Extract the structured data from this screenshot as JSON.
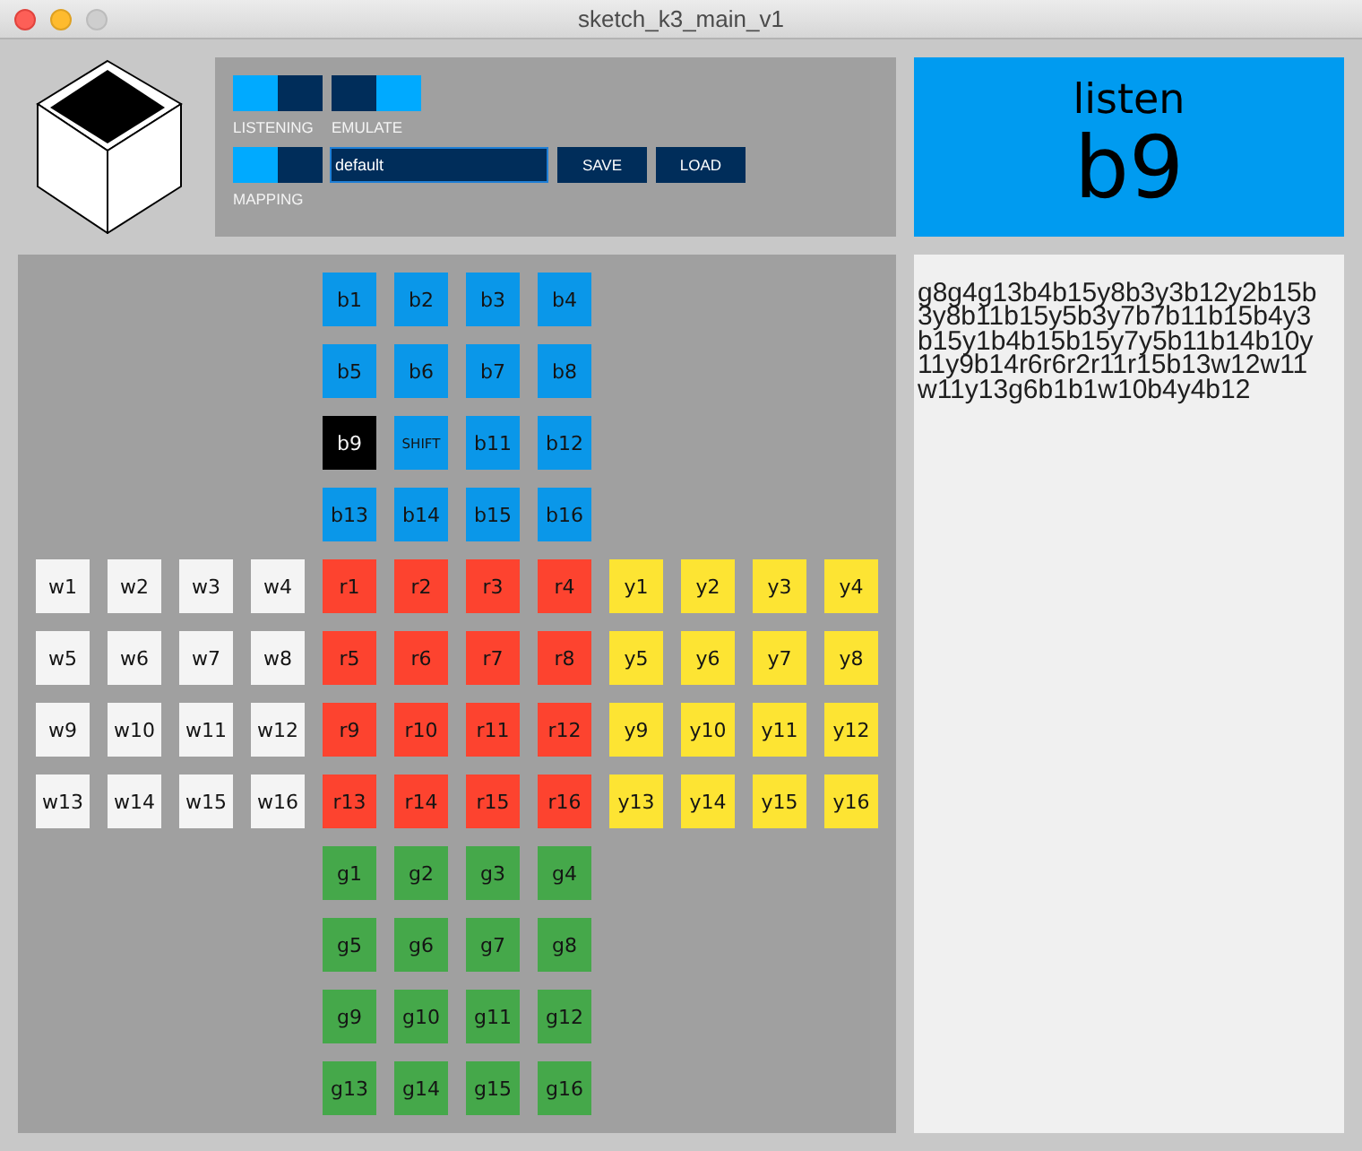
{
  "window": {
    "title": "sketch_k3_main_v1"
  },
  "control_rows": [
    {
      "toggles": [
        {
          "label": "LISTENING",
          "segments": [
            {
              "selected": true
            },
            {
              "selected": false
            }
          ]
        },
        {
          "label": "EMULATE",
          "segments": [
            {
              "selected": false
            },
            {
              "selected": true
            }
          ]
        }
      ]
    },
    {
      "toggles": [
        {
          "label": "MAPPING",
          "segments": [
            {
              "selected": true
            },
            {
              "selected": false
            }
          ]
        }
      ],
      "field": {
        "value": "default"
      },
      "buttons": [
        "SAVE",
        "LOAD"
      ]
    }
  ],
  "status": {
    "mode": "listen",
    "key": "b9"
  },
  "pad_groups": [
    {
      "color": "#0a97e9",
      "pads": [
        {
          "label": "b1",
          "kind": "key",
          "selected": false
        },
        {
          "label": "b2",
          "kind": "key",
          "selected": false
        },
        {
          "label": "b3",
          "kind": "key",
          "selected": false
        },
        {
          "label": "b4",
          "kind": "key",
          "selected": false
        },
        {
          "label": "b5",
          "kind": "key",
          "selected": false
        },
        {
          "label": "b6",
          "kind": "key",
          "selected": false
        },
        {
          "label": "b7",
          "kind": "key",
          "selected": false
        },
        {
          "label": "b8",
          "kind": "key",
          "selected": false
        },
        {
          "label": "b9",
          "kind": "key",
          "selected": true
        },
        {
          "label": "SHIFT",
          "kind": "modifier",
          "selected": false
        },
        {
          "label": "b11",
          "kind": "key",
          "selected": false
        },
        {
          "label": "b12",
          "kind": "key",
          "selected": false
        },
        {
          "label": "b13",
          "kind": "key",
          "selected": false
        },
        {
          "label": "b14",
          "kind": "key",
          "selected": false
        },
        {
          "label": "b15",
          "kind": "key",
          "selected": false
        },
        {
          "label": "b16",
          "kind": "key",
          "selected": false
        }
      ]
    },
    {
      "color": "#f4f4f4",
      "pads": [
        {
          "label": "w1",
          "selected": false
        },
        {
          "label": "w2",
          "selected": false
        },
        {
          "label": "w3",
          "selected": false
        },
        {
          "label": "w4",
          "selected": false
        },
        {
          "label": "w5",
          "selected": false
        },
        {
          "label": "w6",
          "selected": false
        },
        {
          "label": "w7",
          "selected": false
        },
        {
          "label": "w8",
          "selected": false
        },
        {
          "label": "w9",
          "selected": false
        },
        {
          "label": "w10",
          "selected": false
        },
        {
          "label": "w11",
          "selected": false
        },
        {
          "label": "w12",
          "selected": false
        },
        {
          "label": "w13",
          "selected": false
        },
        {
          "label": "w14",
          "selected": false
        },
        {
          "label": "w15",
          "selected": false
        },
        {
          "label": "w16",
          "selected": false
        }
      ]
    },
    {
      "color": "#fd432f",
      "pads": [
        {
          "label": "r1",
          "selected": false
        },
        {
          "label": "r2",
          "selected": false
        },
        {
          "label": "r3",
          "selected": false
        },
        {
          "label": "r4",
          "selected": false
        },
        {
          "label": "r5",
          "selected": false
        },
        {
          "label": "r6",
          "selected": false
        },
        {
          "label": "r7",
          "selected": false
        },
        {
          "label": "r8",
          "selected": false
        },
        {
          "label": "r9",
          "selected": false
        },
        {
          "label": "r10",
          "selected": false
        },
        {
          "label": "r11",
          "selected": false
        },
        {
          "label": "r12",
          "selected": false
        },
        {
          "label": "r13",
          "selected": false
        },
        {
          "label": "r14",
          "selected": false
        },
        {
          "label": "r15",
          "selected": false
        },
        {
          "label": "r16",
          "selected": false
        }
      ]
    },
    {
      "color": "#fde433",
      "pads": [
        {
          "label": "y1",
          "selected": false
        },
        {
          "label": "y2",
          "selected": false
        },
        {
          "label": "y3",
          "selected": false
        },
        {
          "label": "y4",
          "selected": false
        },
        {
          "label": "y5",
          "selected": false
        },
        {
          "label": "y6",
          "selected": false
        },
        {
          "label": "y7",
          "selected": false
        },
        {
          "label": "y8",
          "selected": false
        },
        {
          "label": "y9",
          "selected": false
        },
        {
          "label": "y10",
          "selected": false
        },
        {
          "label": "y11",
          "selected": false
        },
        {
          "label": "y12",
          "selected": false
        },
        {
          "label": "y13",
          "selected": false
        },
        {
          "label": "y14",
          "selected": false
        },
        {
          "label": "y15",
          "selected": false
        },
        {
          "label": "y16",
          "selected": false
        }
      ]
    },
    {
      "color": "#45a84a",
      "pads": [
        {
          "label": "g1",
          "selected": false
        },
        {
          "label": "g2",
          "selected": false
        },
        {
          "label": "g3",
          "selected": false
        },
        {
          "label": "g4",
          "selected": false
        },
        {
          "label": "g5",
          "selected": false
        },
        {
          "label": "g6",
          "selected": false
        },
        {
          "label": "g7",
          "selected": false
        },
        {
          "label": "g8",
          "selected": false
        },
        {
          "label": "g9",
          "selected": false
        },
        {
          "label": "g10",
          "selected": false
        },
        {
          "label": "g11",
          "selected": false
        },
        {
          "label": "g12",
          "selected": false
        },
        {
          "label": "g13",
          "selected": false
        },
        {
          "label": "g14",
          "selected": false
        },
        {
          "label": "g15",
          "selected": false
        },
        {
          "label": "g16",
          "selected": false
        }
      ]
    }
  ],
  "log": {
    "lines": [
      "g8g4g13b4b15y8b3y3b12y2b15b",
      "3y8b11b15y5b3y7b7b11b15b4y3",
      "b15y1b4b15b15y7y5b11b14b10y",
      "11y9b14r6r6r2r11r15b13w12w11",
      "w11y13g6b1b1w10b4y4b12"
    ]
  }
}
